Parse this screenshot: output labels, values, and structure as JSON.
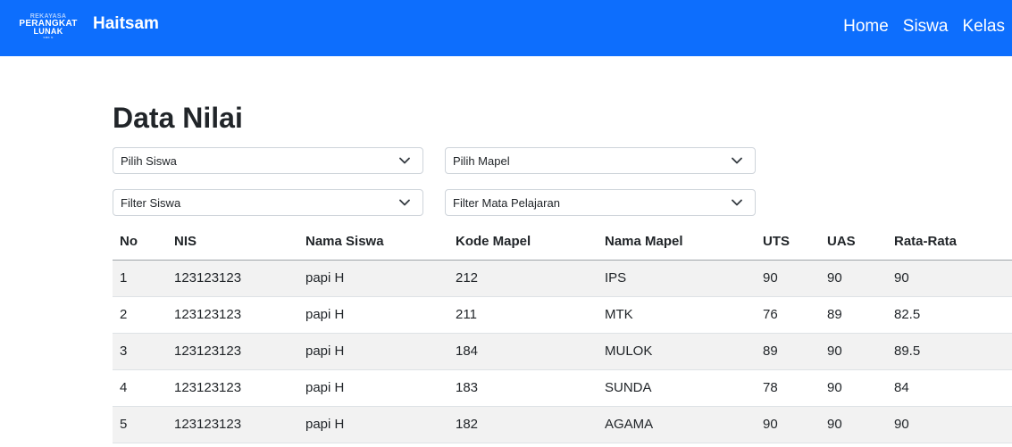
{
  "navbar": {
    "logo_lines": [
      "REKAYASA",
      "PERANGKAT",
      "LUNAK",
      "SMK N"
    ],
    "brand": "Haitsam",
    "links": [
      "Home",
      "Siswa",
      "Kelas"
    ]
  },
  "page": {
    "title": "Data Nilai"
  },
  "filters": {
    "pilih_siswa": "Pilih Siswa",
    "pilih_mapel": "Pilih Mapel",
    "filter_siswa": "Filter Siswa",
    "filter_mapel": "Filter Mata Pelajaran"
  },
  "table": {
    "headers": [
      "No",
      "NIS",
      "Nama Siswa",
      "Kode Mapel",
      "Nama Mapel",
      "UTS",
      "UAS",
      "Rata-Rata"
    ],
    "rows": [
      [
        "1",
        "123123123",
        "papi H",
        "212",
        "IPS",
        "90",
        "90",
        "90"
      ],
      [
        "2",
        "123123123",
        "papi H",
        "211",
        "MTK",
        "76",
        "89",
        "82.5"
      ],
      [
        "3",
        "123123123",
        "papi H",
        "184",
        "MULOK",
        "89",
        "90",
        "89.5"
      ],
      [
        "4",
        "123123123",
        "papi H",
        "183",
        "SUNDA",
        "78",
        "90",
        "84"
      ],
      [
        "5",
        "123123123",
        "papi H",
        "182",
        "AGAMA",
        "90",
        "90",
        "90"
      ]
    ]
  },
  "colors": {
    "navbar": "#0d6efd",
    "striped_row": "#f2f2f2"
  }
}
